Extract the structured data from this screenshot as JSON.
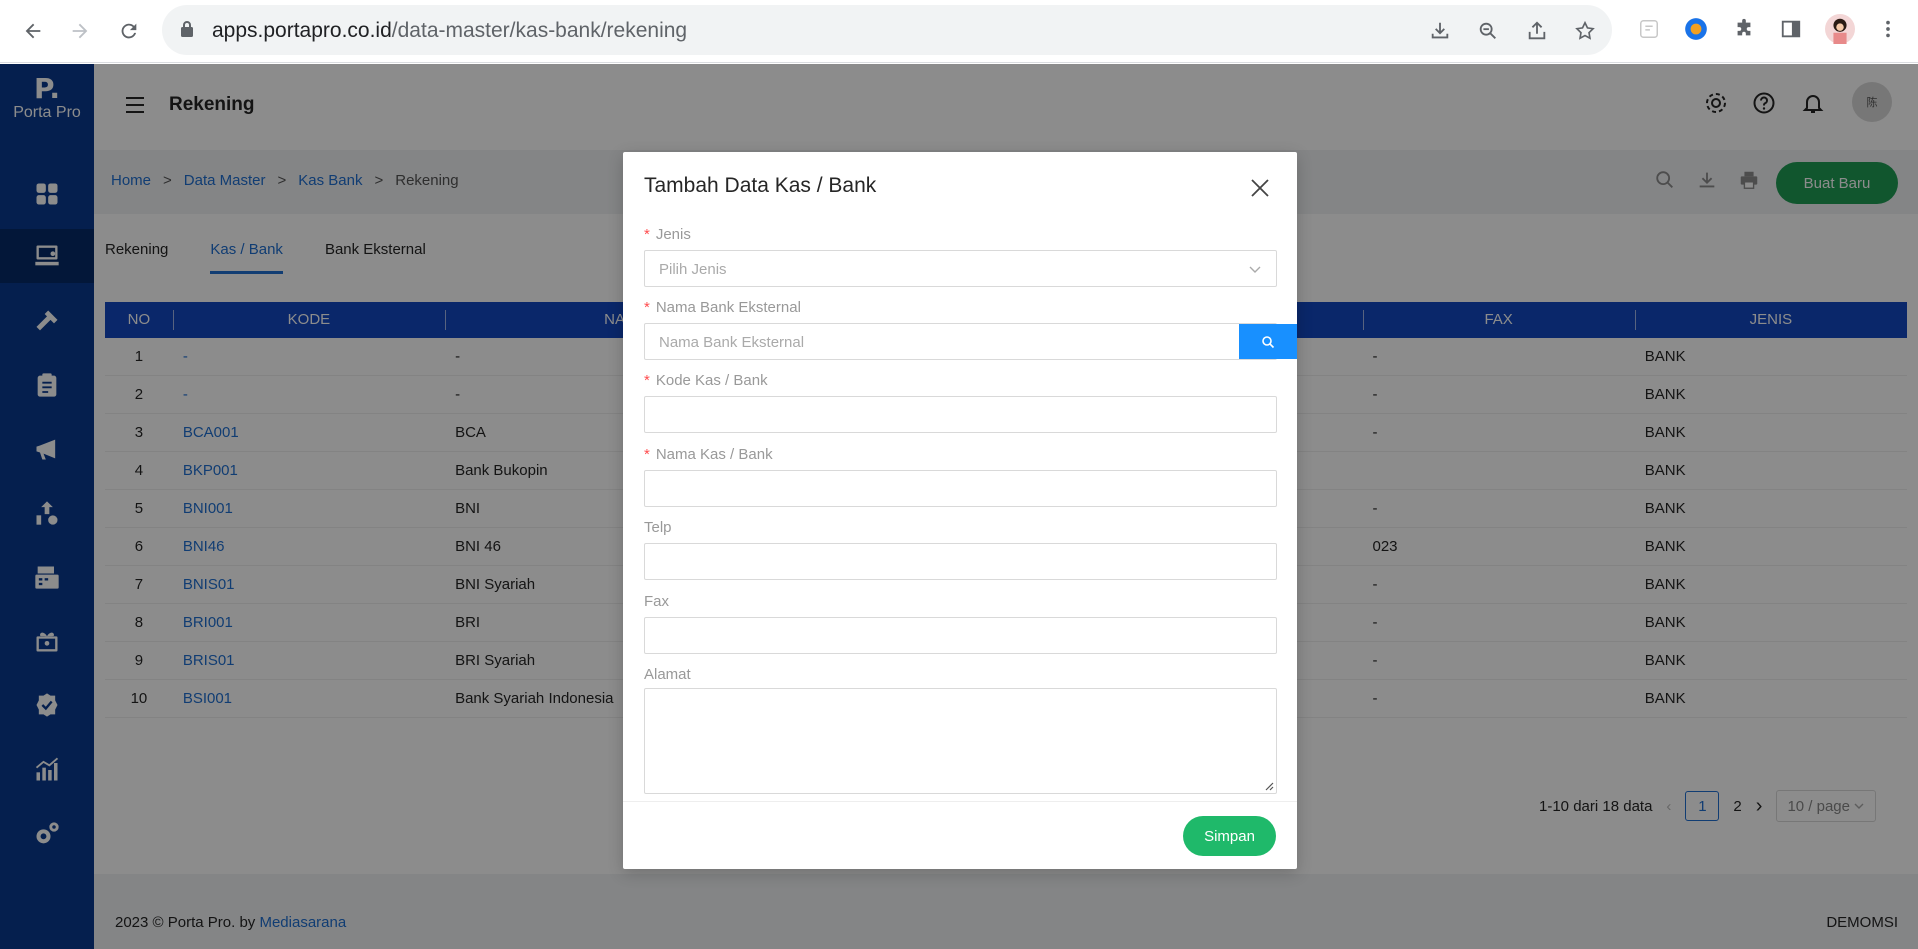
{
  "browser": {
    "url_host": "apps.portapro.co.id",
    "url_path": "/data-master/kas-bank/rekening"
  },
  "sidebar": {
    "logo_mark": "P.",
    "logo_name": "Porta Pro"
  },
  "header": {
    "title": "Rekening",
    "avatar_text": "陈"
  },
  "breadcrumb": {
    "items": [
      "Home",
      "Data Master",
      "Kas Bank"
    ],
    "current": "Rekening",
    "separator": ">"
  },
  "toolbar": {
    "new_label": "Buat Baru"
  },
  "tabs": [
    "Rekening",
    "Kas / Bank",
    "Bank Eksternal"
  ],
  "table": {
    "headers": [
      "NO",
      "KODE",
      "NA",
      "FAX",
      "JENIS"
    ],
    "rows": [
      {
        "no": "1",
        "kode": "-",
        "nama": "-",
        "fax": "-",
        "jenis": "BANK"
      },
      {
        "no": "2",
        "kode": "-",
        "nama": "-",
        "fax": "-",
        "jenis": "BANK"
      },
      {
        "no": "3",
        "kode": "BCA001",
        "nama": "BCA",
        "fax": "-",
        "jenis": "BANK"
      },
      {
        "no": "4",
        "kode": "BKP001",
        "nama": "Bank Bukopin",
        "fax": "",
        "jenis": "BANK"
      },
      {
        "no": "5",
        "kode": "BNI001",
        "nama": "BNI",
        "fax": "-",
        "jenis": "BANK"
      },
      {
        "no": "6",
        "kode": "BNI46",
        "nama": "BNI 46",
        "fax": "023",
        "jenis": "BANK"
      },
      {
        "no": "7",
        "kode": "BNIS01",
        "nama": "BNI Syariah",
        "fax": "-",
        "jenis": "BANK"
      },
      {
        "no": "8",
        "kode": "BRI001",
        "nama": "BRI",
        "fax": "-",
        "jenis": "BANK"
      },
      {
        "no": "9",
        "kode": "BRIS01",
        "nama": "BRI Syariah",
        "fax": "-",
        "jenis": "BANK"
      },
      {
        "no": "10",
        "kode": "BSI001",
        "nama": "Bank Syariah Indonesia",
        "fax": "-",
        "jenis": "BANK"
      }
    ]
  },
  "pagination": {
    "summary": "1-10 dari 18 data",
    "page_current": "1",
    "page_next": "2",
    "page_size": "10 / page"
  },
  "footer": {
    "copyright": "2023 © Porta Pro. by ",
    "brand": "Mediasarana",
    "tenant": "DEMOMSI"
  },
  "modal": {
    "title": "Tambah Data Kas / Bank",
    "required_mark": "*",
    "fields": {
      "jenis_label": "Jenis",
      "jenis_placeholder": "Pilih Jenis",
      "bank_eksternal_label": "Nama Bank Eksternal",
      "bank_eksternal_placeholder": "Nama Bank Eksternal",
      "kode_label": "Kode Kas / Bank",
      "nama_label": "Nama Kas / Bank",
      "telp_label": "Telp",
      "fax_label": "Fax",
      "alamat_label": "Alamat"
    },
    "save_label": "Simpan"
  },
  "colors": {
    "sidebar": "#0a3a8f",
    "table_header": "#1348c2",
    "primary_link": "#1f6fd1",
    "save_button": "#1fb96a",
    "new_button": "#1f9d55",
    "search_button": "#1890ff"
  }
}
